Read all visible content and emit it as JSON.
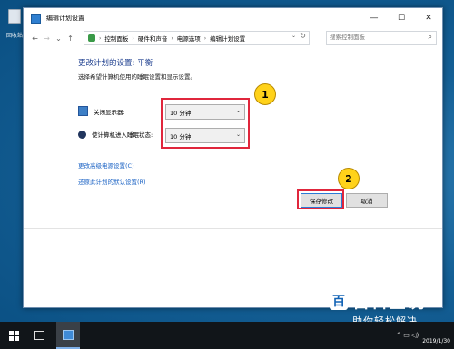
{
  "desktop": {
    "recycle_bin_label": "回收站"
  },
  "window": {
    "title": "编辑计划设置",
    "controls": {
      "minimize": "—",
      "maximize": "☐",
      "close": "✕"
    }
  },
  "nav": {
    "back": "←",
    "forward": "→",
    "up_dropdown": "⌄",
    "up": "↑"
  },
  "address": {
    "crumbs": [
      "控制面板",
      "硬件和声音",
      "电源选项",
      "编辑计划设置"
    ],
    "separator": "›",
    "dropdown": "⌄",
    "refresh": "↻"
  },
  "search": {
    "placeholder": "搜索控制面板",
    "icon": "⌕"
  },
  "content": {
    "heading": "更改计划的设置: 平衡",
    "subtitle": "选择希望计算机使用的睡眠设置和显示设置。",
    "display_off_label": "关闭显示器:",
    "display_off_value": "10 分钟",
    "sleep_label": "使计算机进入睡眠状态:",
    "sleep_value": "10 分钟",
    "dropdown_chevron": "⌄",
    "advanced_link": "更改高级电源设置(C)",
    "restore_link": "还原此计划的默认设置(R)",
    "save_button": "保存修改",
    "cancel_button": "取消"
  },
  "annotations": {
    "badge1": "1",
    "badge2": "2",
    "highlight_color": "#e0263c",
    "badge_color": "#ffd21a"
  },
  "taskbar": {
    "tray_icons": "^ ▭ ◁)",
    "date": "2019/1/30"
  },
  "watermark": {
    "mark": "百",
    "main": "百科全说",
    "sub": "助你轻松解决"
  },
  "colors": {
    "link": "#1a62c4",
    "heading": "#1e3f8f",
    "desktop": "#145f95"
  }
}
